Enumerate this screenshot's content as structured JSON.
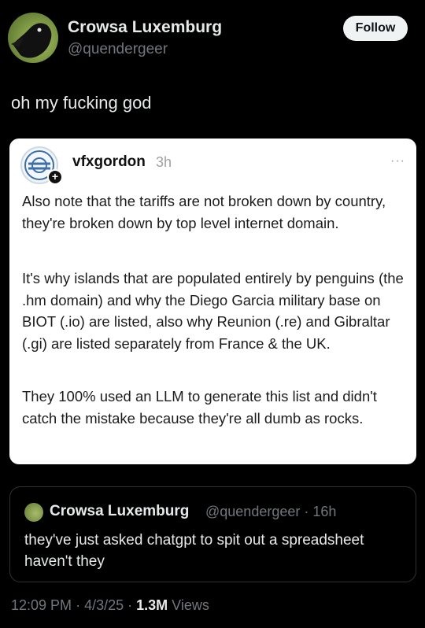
{
  "author": {
    "name": "Crowsa Luxemburg",
    "handle": "@quendergeer",
    "avatar_icon": "crow-avatar-icon"
  },
  "follow_label": "Follow",
  "tweet_text": "oh my fucking god",
  "embedded_post": {
    "avatar_icon": "circular-logo-avatar-icon",
    "plus_symbol": "+",
    "username": "vfxgordon",
    "time": "3h",
    "more_symbol": "···",
    "paragraphs": [
      "Also note that the tariffs are not broken down by country, they're broken down by top level internet domain.",
      "It's why islands that are populated entirely by penguins (the .hm domain) and why the Diego Garcia military base on BIOT (.io) are listed, also why Reunion (.re) and Gibraltar (.gi) are listed separately from France & the UK.",
      "They 100% used an LLM to generate this list and didn't catch the mistake because they're all dumb as rocks."
    ]
  },
  "quoted_tweet": {
    "name": "Crowsa Luxemburg",
    "handle_time": "@quendergeer · 16h",
    "text": "they've just asked chatgpt to spit out a spreadsheet haven't they"
  },
  "meta": {
    "time": "12:09 PM",
    "date": "4/3/25",
    "views_count": "1.3M",
    "views_label": "Views"
  }
}
